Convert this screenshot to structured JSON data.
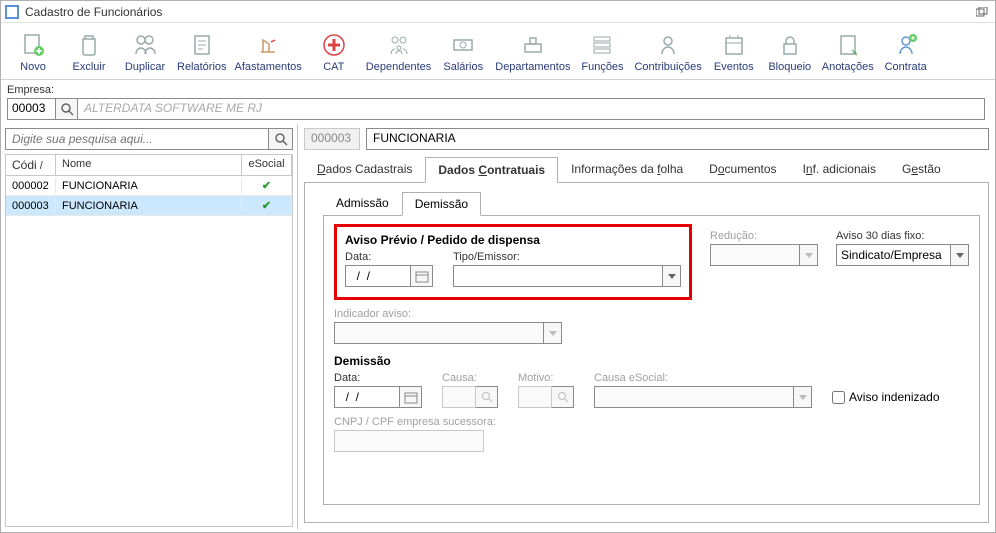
{
  "window": {
    "title": "Cadastro de Funcionários"
  },
  "toolbar": [
    {
      "icon": "new",
      "label": "Novo"
    },
    {
      "icon": "delete",
      "label": "Excluir"
    },
    {
      "icon": "duplicate",
      "label": "Duplicar"
    },
    {
      "icon": "reports",
      "label": "Relatórios"
    },
    {
      "icon": "away",
      "label": "Afastamentos"
    },
    {
      "icon": "cat",
      "label": "CAT"
    },
    {
      "icon": "dependents",
      "label": "Dependentes"
    },
    {
      "icon": "salaries",
      "label": "Salários"
    },
    {
      "icon": "departments",
      "label": "Departamentos"
    },
    {
      "icon": "functions",
      "label": "Funções"
    },
    {
      "icon": "contrib",
      "label": "Contribuições"
    },
    {
      "icon": "events",
      "label": "Eventos"
    },
    {
      "icon": "lock",
      "label": "Bloqueio"
    },
    {
      "icon": "notes",
      "label": "Anotações"
    },
    {
      "icon": "contracts",
      "label": "Contrata"
    }
  ],
  "empresa": {
    "label": "Empresa:",
    "code": "00003",
    "name_placeholder": "ALTERDATA SOFTWARE ME RJ"
  },
  "leftSearch": {
    "placeholder": "Digite sua pesquisa aqui..."
  },
  "grid": {
    "headers": {
      "codi": "Códi",
      "nome": "Nome",
      "esocial": "eSocial"
    },
    "rows": [
      {
        "codi": "000002",
        "nome": "FUNCIONARIA",
        "ok": "✔"
      },
      {
        "codi": "000003",
        "nome": "FUNCIONARIA",
        "ok": "✔"
      }
    ]
  },
  "rightSearch": {
    "code": "000003",
    "name": "FUNCIONARIA"
  },
  "mainTabs": {
    "t1": {
      "pre": "",
      "ul": "D",
      "post": "ados Cadastrais"
    },
    "t2": {
      "pre": "Dados ",
      "ul": "C",
      "post": "ontratuais"
    },
    "t3": {
      "pre": "Informações da ",
      "ul": "f",
      "post": "olha"
    },
    "t4": {
      "pre": "D",
      "ul": "o",
      "post": "cumentos"
    },
    "t5": {
      "pre": "I",
      "ul": "n",
      "post": "f. adicionais"
    },
    "t6": {
      "pre": "G",
      "ul": "e",
      "post": "stão"
    }
  },
  "subTabs": {
    "admissao": "Admissão",
    "demissao": "Demissão"
  },
  "aviso": {
    "title": "Aviso Prévio / Pedido de dispensa",
    "data_label": "Data:",
    "data_value": "  /  /",
    "tipo_label": "Tipo/Emissor:",
    "tipo_value": "",
    "reducao_label": "Redução:",
    "reducao_value": "",
    "aviso30_label": "Aviso 30 dias fixo:",
    "aviso30_value": "Sindicato/Empresa",
    "indicador_label": "Indicador aviso:",
    "indicador_value": ""
  },
  "demissao": {
    "title": "Demissão",
    "data_label": "Data:",
    "data_value": "  /  /",
    "causa_label": "Causa:",
    "causa_value": "",
    "motivo_label": "Motivo:",
    "motivo_value": "",
    "causa_esocial_label": "Causa eSocial:",
    "causa_esocial_value": "",
    "aviso_inden_label": "Aviso indenizado",
    "cnpj_label": "CNPJ / CPF empresa sucessora:",
    "cnpj_value": ""
  }
}
